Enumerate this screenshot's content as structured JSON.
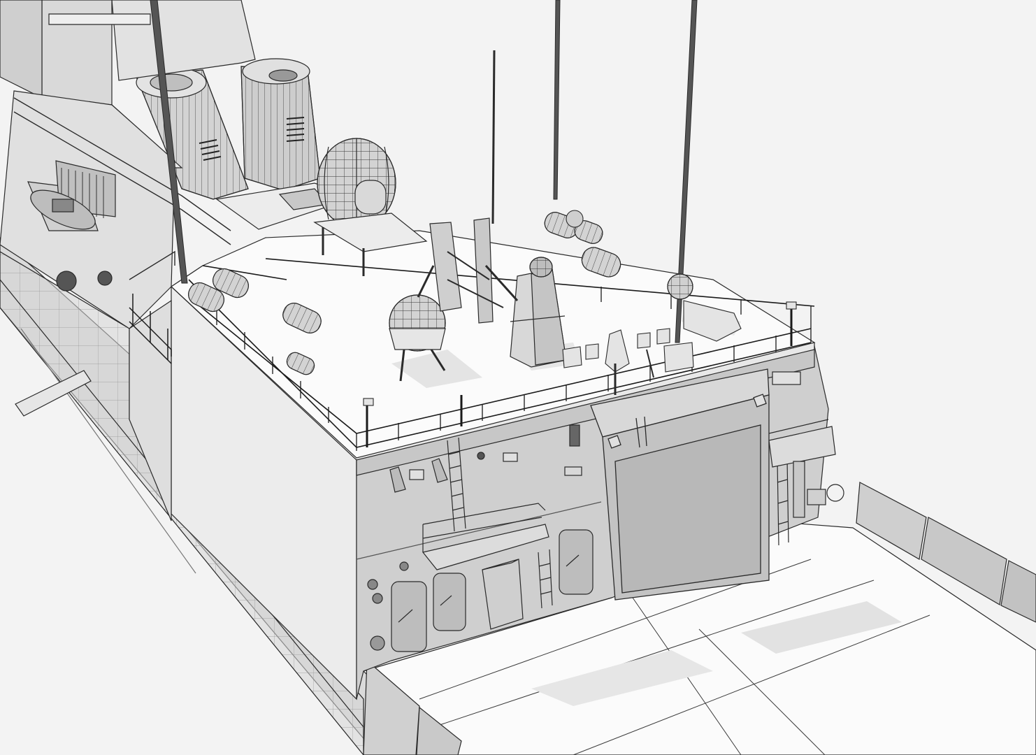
{
  "image": {
    "kind": "3D wireframe render of a naval frigate, stern flight deck and hangar",
    "text_visible": false
  },
  "palette": {
    "background": "#f3f3f3",
    "deck": "#fbfbfb",
    "hull_light": "#ececec",
    "hull_mid": "#d9d9d9",
    "hull_dark": "#c4c4c4",
    "wire": "#2a2a2a",
    "shadow": "#dcdcdc"
  },
  "parts": [
    {
      "id": "hangar-door",
      "icon": "hangar-door-icon"
    },
    {
      "id": "radar-dome",
      "icon": "radar-dome-icon"
    },
    {
      "id": "exhaust-funnel",
      "icon": "funnel-icon"
    },
    {
      "id": "mast",
      "icon": "mast-icon"
    },
    {
      "id": "life-raft-canister",
      "icon": "liferaft-icon"
    },
    {
      "id": "railing",
      "icon": "railing-icon"
    },
    {
      "id": "ladder",
      "icon": "ladder-icon"
    },
    {
      "id": "rigid-inflatable-boat",
      "icon": "boat-icon"
    }
  ]
}
